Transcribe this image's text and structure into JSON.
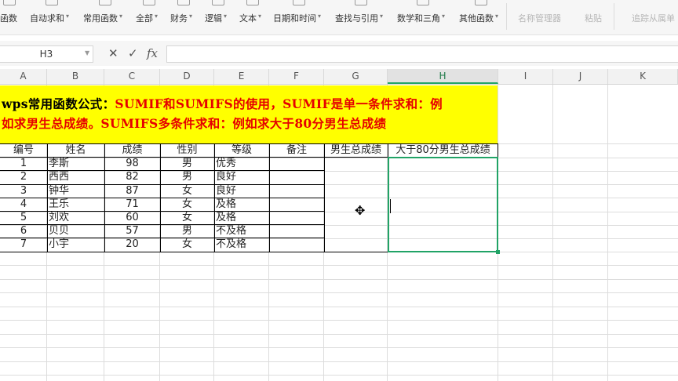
{
  "ribbon": {
    "items": [
      {
        "label": "函数",
        "dropdown": false
      },
      {
        "label": "自动求和",
        "dropdown": true
      },
      {
        "label": "常用函数",
        "dropdown": true
      },
      {
        "label": "全部",
        "dropdown": true
      },
      {
        "label": "财务",
        "dropdown": true
      },
      {
        "label": "逻辑",
        "dropdown": true
      },
      {
        "label": "文本",
        "dropdown": true
      },
      {
        "label": "日期和时间",
        "dropdown": true
      },
      {
        "label": "查找与引用",
        "dropdown": true
      },
      {
        "label": "数学和三角",
        "dropdown": true
      },
      {
        "label": "其他函数",
        "dropdown": true
      }
    ],
    "right_items": [
      "名称管理器",
      "粘贴",
      "追踪从属单"
    ]
  },
  "formula_bar": {
    "name_box": "H3",
    "cancel_icon": "✕",
    "confirm_icon": "✓",
    "fx_icon": "fx",
    "formula": ""
  },
  "columns": [
    "A",
    "B",
    "C",
    "D",
    "E",
    "F",
    "G",
    "H",
    "I",
    "J",
    "K"
  ],
  "selected_column": "H",
  "title": {
    "prefix": "wps常用函数公式：",
    "line1_rest": "SUMIF和SUMIFS的使用，SUMIF是单一条件求和：例",
    "line2": "如求男生总成绩。SUMIFS多条件求和：例如求大于80分男生总成绩"
  },
  "table": {
    "headers": [
      "编号",
      "姓名",
      "成绩",
      "性别",
      "等级",
      "备注",
      "男生总成绩",
      "大于80分男生总成绩"
    ],
    "rows": [
      [
        "1",
        "李斯",
        "98",
        "男",
        "优秀",
        ""
      ],
      [
        "2",
        "西西",
        "82",
        "男",
        "良好",
        ""
      ],
      [
        "3",
        "钟华",
        "87",
        "女",
        "良好",
        ""
      ],
      [
        "4",
        "王乐",
        "71",
        "女",
        "及格",
        ""
      ],
      [
        "5",
        "刘欢",
        "60",
        "女",
        "及格",
        ""
      ],
      [
        "6",
        "贝贝",
        "57",
        "男",
        "不及格",
        ""
      ],
      [
        "7",
        "小宇",
        "20",
        "女",
        "不及格",
        ""
      ]
    ]
  },
  "colors": {
    "title_bg": "#ffff00",
    "title_red": "#e60000",
    "selection": "#21a366"
  }
}
